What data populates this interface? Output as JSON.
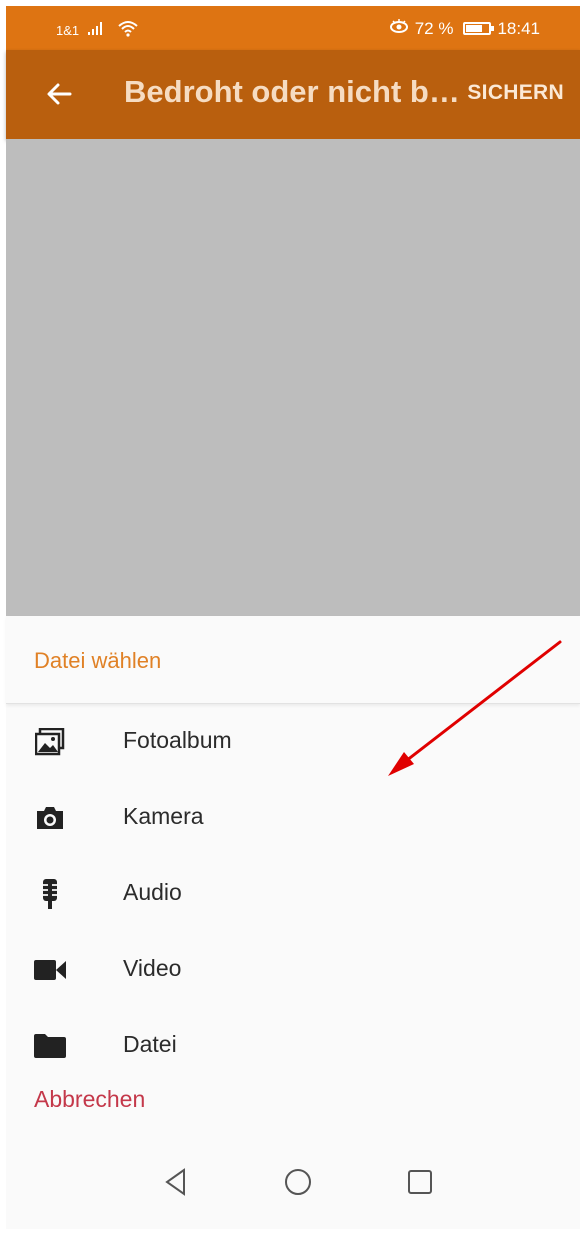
{
  "status_bar": {
    "carrier": "1&1",
    "battery_percent": "72 %",
    "battery_level": 0.72,
    "time": "18:41"
  },
  "app_bar": {
    "title": "Bedroht oder nicht b…",
    "save_label": "SICHERN"
  },
  "sheet": {
    "title": "Datei wählen",
    "items": [
      {
        "label": "Fotoalbum",
        "icon": "photo-album-icon"
      },
      {
        "label": "Kamera",
        "icon": "camera-icon"
      },
      {
        "label": "Audio",
        "icon": "microphone-icon"
      },
      {
        "label": "Video",
        "icon": "video-camera-icon"
      },
      {
        "label": "Datei",
        "icon": "folder-icon"
      }
    ],
    "cancel_label": "Abbrechen"
  },
  "colors": {
    "status_bar": "#de7412",
    "app_bar": "#b95f0e",
    "accent": "#e08126",
    "cancel": "#c4384a",
    "annotation_arrow": "#e00000"
  }
}
